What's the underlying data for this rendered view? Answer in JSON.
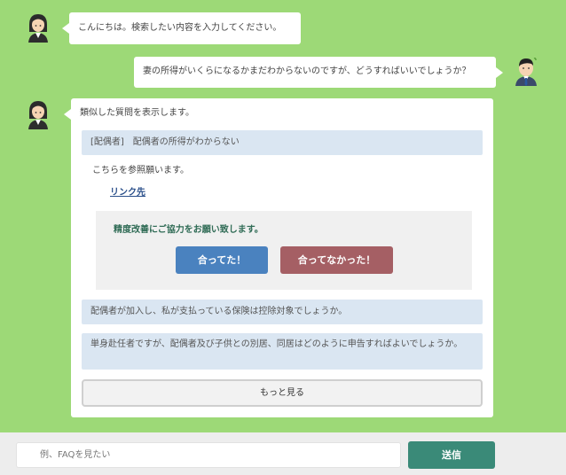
{
  "messages": {
    "bot_greeting": "こんにちは。検索したい内容を入力してください。",
    "user_question": "妻の所得がいくらになるかまだわからないのですが、どうすればいいでしょうか？",
    "bot_intro": "類似した質問を表示します。"
  },
  "result": {
    "top_question": "[配偶者]　配偶者の所得がわからない",
    "answer_text": "こちらを参照願います。",
    "link_label": "リンク先",
    "feedback_title": "精度改善にご協力をお願い致します。",
    "yes_label": "合ってた！",
    "no_label": "合ってなかった！"
  },
  "related": [
    "配偶者が加入し、私が支払っている保険は控除対象でしょうか。",
    "単身赴任者ですが、配偶者及び子供との別居、同居はどのように申告すればよいでしょうか。"
  ],
  "more_label": "もっと見る",
  "input": {
    "placeholder": "例、FAQを見たい",
    "value": ""
  },
  "send_label": "送信",
  "colors": {
    "background": "#9dd977",
    "yes_button": "#4a82bf",
    "no_button": "#a55f64",
    "send_button": "#3a8a78",
    "related_bg": "#dae6f2"
  },
  "icons": {
    "bot_avatar": "woman-operator-avatar-icon",
    "user_avatar": "man-user-avatar-icon"
  }
}
